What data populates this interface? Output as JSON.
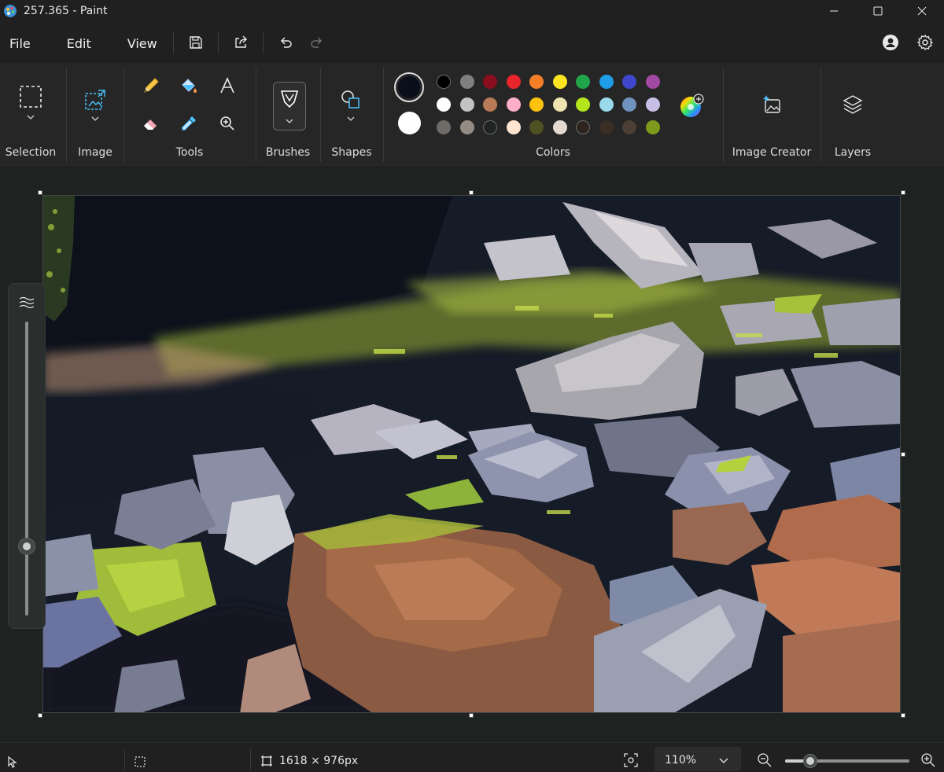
{
  "window": {
    "title": "257.365 - Paint"
  },
  "menu": {
    "file": "File",
    "edit": "Edit",
    "view": "View"
  },
  "ribbon": {
    "groups": {
      "selection": "Selection",
      "image": "Image",
      "tools": "Tools",
      "brushes": "Brushes",
      "shapes": "Shapes",
      "colors": "Colors",
      "image_creator": "Image Creator",
      "layers": "Layers"
    },
    "primary_color": "#0b0f1c",
    "secondary_color": "#ffffff",
    "palette": [
      [
        "#000000",
        "#7f7f7f",
        "#8b0e1e",
        "#e8252b",
        "#f57f27",
        "#fbe621",
        "#21a54a",
        "#1f9de6",
        "#3f48cc",
        "#a349a4"
      ],
      [
        "#ffffff",
        "#c3c3c3",
        "#b97a57",
        "#ffaec9",
        "#ffc20e",
        "#efe4b0",
        "#b5e61d",
        "#99d9ea",
        "#7092be",
        "#c8bfe7"
      ],
      [
        "#6f6b66",
        "#948c84",
        "#1f2322",
        "#ffe5cf",
        "#4e5222",
        "#e3d9d2",
        "#2e2520",
        "#3a2e25",
        "#4c3e34",
        "#7e9a1c"
      ]
    ]
  },
  "status": {
    "canvas_size": "1618 × 976px",
    "zoom": "110%",
    "zoom_level": 0.2
  }
}
